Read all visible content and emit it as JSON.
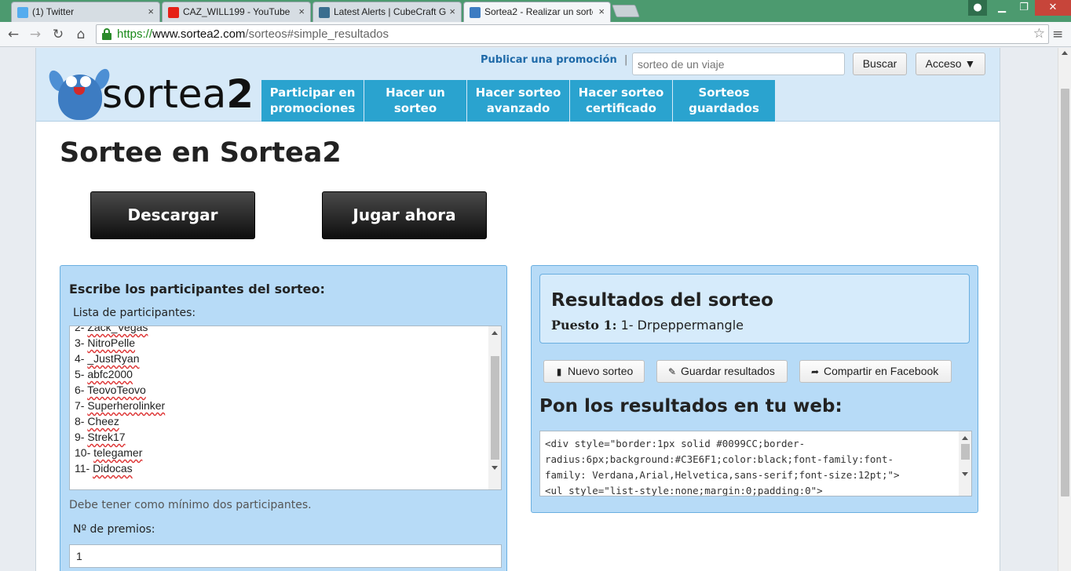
{
  "browser": {
    "tabs": [
      {
        "title": "(1) Twitter",
        "favicon": "twitter-icon",
        "color": "#55acee"
      },
      {
        "title": "CAZ_WILL199 - YouTube",
        "favicon": "youtube-icon",
        "color": "#e62117"
      },
      {
        "title": "Latest Alerts | CubeCraft G",
        "favicon": "cube-icon",
        "color": "#3b6e8f"
      },
      {
        "title": "Sortea2 - Realizar un sorte",
        "favicon": "sortea2-icon",
        "color": "#3d7cc2"
      }
    ],
    "close_glyph": "×",
    "url": {
      "scheme": "https://",
      "host": "www.sortea2.com",
      "path": "/sorteos#simple_resultados"
    }
  },
  "header": {
    "logo_text_a": "sortea",
    "logo_text_b": "2",
    "publicar": "Publicar una promoción",
    "pipe": "|",
    "search_placeholder": "sorteo de un viaje",
    "buscar": "Buscar",
    "acceso": "Acceso ▼",
    "nav": [
      {
        "line1": "Participar en",
        "line2": "promociones"
      },
      {
        "line1": "Hacer un",
        "line2": "sorteo"
      },
      {
        "line1": "Hacer sorteo",
        "line2": "avanzado"
      },
      {
        "line1": "Hacer sorteo",
        "line2": "certificado"
      },
      {
        "line1": "Sorteos",
        "line2": "guardados"
      }
    ]
  },
  "main": {
    "title": "Sortee en Sortea2",
    "descargar": "Descargar",
    "jugar": "Jugar ahora"
  },
  "left_panel": {
    "heading": "Escribe los participantes del sorteo:",
    "list_label": "Lista de participantes:",
    "participants": [
      {
        "num": "2-",
        "name": "Zack_Vegas"
      },
      {
        "num": "3-",
        "name": "NitroPelle"
      },
      {
        "num": "4-",
        "name": "_JustRyan"
      },
      {
        "num": "5-",
        "name": "abfc2000"
      },
      {
        "num": "6-",
        "name": "TeovoTeovo"
      },
      {
        "num": "7-",
        "name": "Superherolinker"
      },
      {
        "num": "8-",
        "name": "Cheez"
      },
      {
        "num": "9-",
        "name": "Strek17"
      },
      {
        "num": "10-",
        "name": "telegamer"
      },
      {
        "num": "11-",
        "name": "Didocas"
      }
    ],
    "hint": "Debe tener como mínimo dos participantes.",
    "premios_label": "Nº de premios:",
    "premios_value": "1"
  },
  "right_panel": {
    "results_title": "Resultados del sorteo",
    "puesto_label": "Puesto 1:",
    "puesto_value": "1- Drpeppermangle",
    "nuevo": "Nuevo sorteo",
    "guardar": "Guardar resultados",
    "facebook": "Compartir en Facebook",
    "web_title": "Pon los resultados en tu web:",
    "code_lines": [
      "<div style=\"border:1px solid #0099CC;border-",
      "radius:6px;background:#C3E6F1;color:black;font-family:font-",
      "family: Verdana,Arial,Helvetica,sans-serif;font-size:12pt;\">",
      "<ul style=\"list-style:none;margin:0;padding:0\">"
    ]
  }
}
